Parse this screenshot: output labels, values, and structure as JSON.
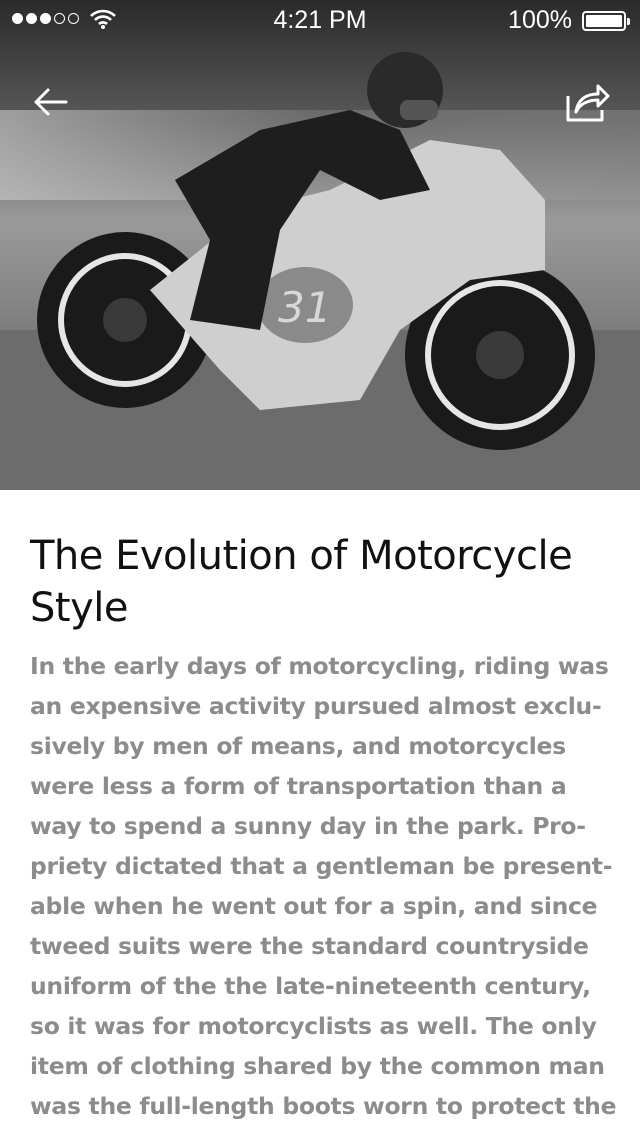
{
  "status_bar": {
    "time": "4:21 PM",
    "battery_percent": "100%",
    "signal_bars_filled": 3,
    "signal_bars_total": 5
  },
  "hero": {
    "number_on_bike": "31",
    "back_icon": "back-arrow-icon",
    "share_icon": "share-icon"
  },
  "article": {
    "title": "The Evolution of Motorcycle Style",
    "body": "In the early days of motorcycling, riding was an expensive activity pursued almost exclu-sively by men of means, and motorcycles were less a form of transportation than a way to spend a sunny day in the park. Pro-priety dictated that a gentleman be present-able when he went out for a spin, and since tweed suits were the standard countryside uniform of the the late-nineteenth century, so it was for motorcyclists as well. The only item of clothing shared by the common man was the full-length boots worn to protect the"
  },
  "colors": {
    "title": "#111111",
    "body": "#8c8c8c",
    "background": "#ffffff"
  }
}
